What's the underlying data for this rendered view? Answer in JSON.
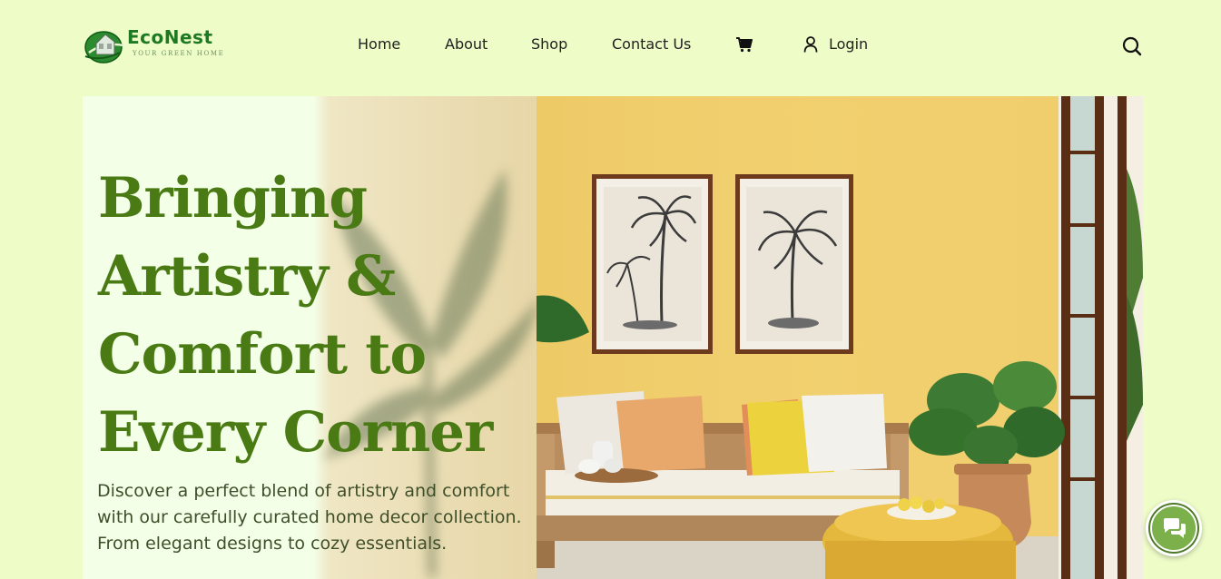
{
  "brand": {
    "name": "EcoNest",
    "tagline": "YOUR GREEN HOME"
  },
  "nav": {
    "items": [
      {
        "label": "Home"
      },
      {
        "label": "About"
      },
      {
        "label": "Shop"
      },
      {
        "label": "Contact Us"
      }
    ],
    "cart_icon": "cart-icon",
    "login_label": "Login",
    "user_icon": "user-icon",
    "search_icon": "search-icon"
  },
  "hero": {
    "title_lines": [
      "Bringing",
      "Artistry &",
      "Comfort to",
      "Every Corner"
    ],
    "description": "Discover a perfect blend of artistry and comfort with our carefully curated home decor collection. From elegant designs to cozy essentials."
  },
  "chat": {
    "icon": "chat-bubbles-icon"
  },
  "colors": {
    "background": "#eefcc8",
    "brand_green": "#1e7a22",
    "title_green": "#4a7a14",
    "chat_green": "#7bb04a"
  }
}
